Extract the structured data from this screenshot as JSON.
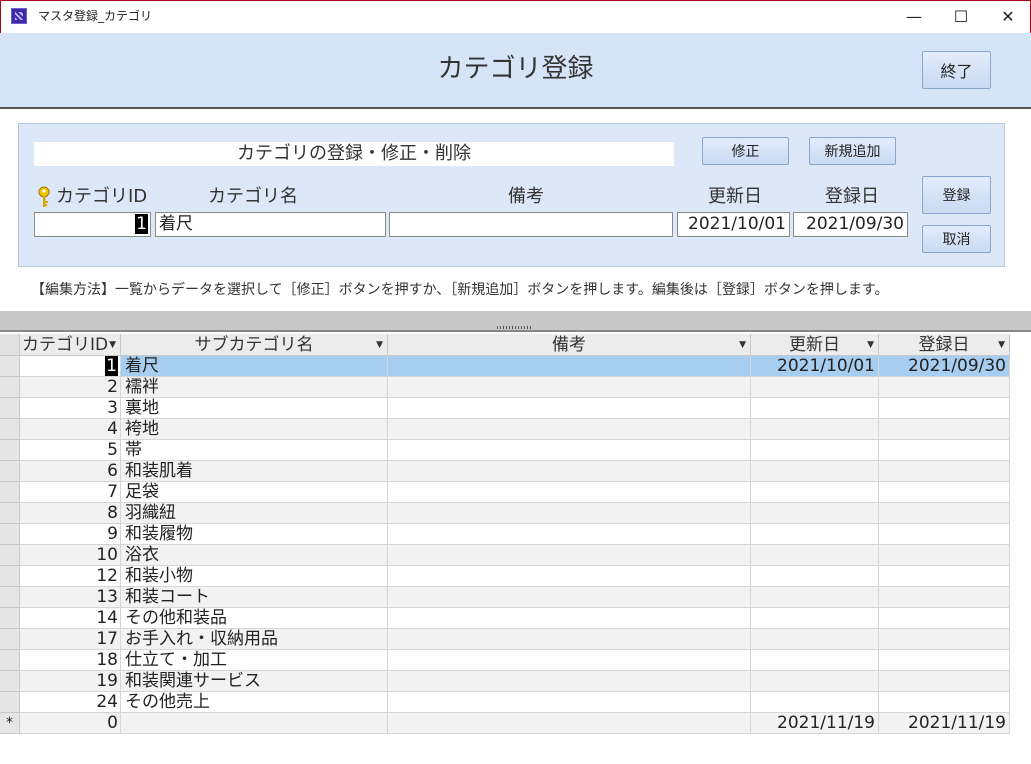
{
  "window": {
    "title": "マスタ登録_カテゴリ",
    "minimize": "—",
    "maximize": "☐",
    "close": "✕"
  },
  "header": {
    "title": "カテゴリ登録",
    "close_label": "終了"
  },
  "panel": {
    "caption": "カテゴリの登録・修正・削除",
    "edit_label": "修正",
    "new_label": "新規追加",
    "save_label": "登録",
    "cancel_label": "取消",
    "labels": {
      "id": "カテゴリID",
      "name": "カテゴリ名",
      "note": "備考",
      "updated": "更新日",
      "registered": "登録日"
    },
    "values": {
      "id": "1",
      "name": "着尺",
      "note": "",
      "updated": "2021/10/01",
      "registered": "2021/09/30"
    }
  },
  "instructions": "【編集方法】一覧からデータを選択して［修正］ボタンを押すか、［新規追加］ボタンを押します。編集後は［登録］ボタンを押します。",
  "grid": {
    "columns": [
      "カテゴリID",
      "サブカテゴリ名",
      "備考",
      "更新日",
      "登録日"
    ],
    "rows": [
      {
        "id": "1",
        "name": "着尺",
        "note": "",
        "updated": "2021/10/01",
        "registered": "2021/09/30"
      },
      {
        "id": "2",
        "name": "襦袢",
        "note": "",
        "updated": "",
        "registered": ""
      },
      {
        "id": "3",
        "name": "裏地",
        "note": "",
        "updated": "",
        "registered": ""
      },
      {
        "id": "4",
        "name": "袴地",
        "note": "",
        "updated": "",
        "registered": ""
      },
      {
        "id": "5",
        "name": "帯",
        "note": "",
        "updated": "",
        "registered": ""
      },
      {
        "id": "6",
        "name": "和装肌着",
        "note": "",
        "updated": "",
        "registered": ""
      },
      {
        "id": "7",
        "name": "足袋",
        "note": "",
        "updated": "",
        "registered": ""
      },
      {
        "id": "8",
        "name": "羽織紐",
        "note": "",
        "updated": "",
        "registered": ""
      },
      {
        "id": "9",
        "name": "和装履物",
        "note": "",
        "updated": "",
        "registered": ""
      },
      {
        "id": "10",
        "name": "浴衣",
        "note": "",
        "updated": "",
        "registered": ""
      },
      {
        "id": "12",
        "name": "和装小物",
        "note": "",
        "updated": "",
        "registered": ""
      },
      {
        "id": "13",
        "name": "和装コート",
        "note": "",
        "updated": "",
        "registered": ""
      },
      {
        "id": "14",
        "name": "その他和装品",
        "note": "",
        "updated": "",
        "registered": ""
      },
      {
        "id": "17",
        "name": "お手入れ・収納用品",
        "note": "",
        "updated": "",
        "registered": ""
      },
      {
        "id": "18",
        "name": "仕立て・加工",
        "note": "",
        "updated": "",
        "registered": ""
      },
      {
        "id": "19",
        "name": "和装関連サービス",
        "note": "",
        "updated": "",
        "registered": ""
      },
      {
        "id": "24",
        "name": "その他売上",
        "note": "",
        "updated": "",
        "registered": ""
      }
    ],
    "new_row": {
      "marker": "*",
      "id": "0",
      "name": "",
      "note": "",
      "updated": "2021/11/19",
      "registered": "2021/11/19"
    },
    "selected_row": 0
  },
  "colors": {
    "header_bg": "#d6e4f7",
    "panel_bg": "#dce8f8",
    "selected_row": "#a7cdf0",
    "alt_row": "#f2f2f2"
  }
}
